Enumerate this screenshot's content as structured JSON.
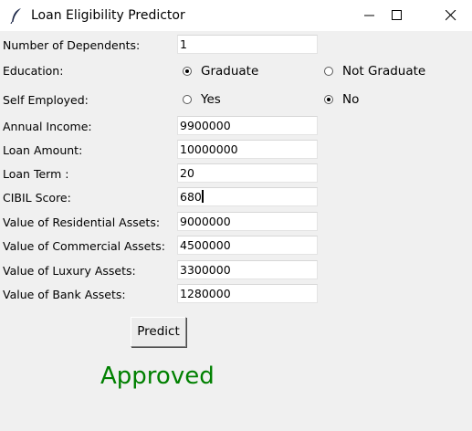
{
  "window": {
    "title": "Loan Eligibility Predictor"
  },
  "form": {
    "dependents": {
      "label": "Number of Dependents:",
      "value": "1"
    },
    "education": {
      "label": "Education:",
      "options": [
        {
          "label": "Graduate",
          "selected": true
        },
        {
          "label": "Not Graduate",
          "selected": false
        }
      ]
    },
    "self_employed": {
      "label": "Self Employed:",
      "options": [
        {
          "label": "Yes",
          "selected": false
        },
        {
          "label": "No",
          "selected": true
        }
      ]
    },
    "annual_income": {
      "label": "Annual Income:",
      "value": "9900000"
    },
    "loan_amount": {
      "label": "Loan Amount:",
      "value": "10000000"
    },
    "loan_term": {
      "label": "Loan Term :",
      "value": "20"
    },
    "cibil_score": {
      "label": "CIBIL Score:",
      "value": "680"
    },
    "residential_assets": {
      "label": "Value of Residential Assets:",
      "value": "9000000"
    },
    "commercial_assets": {
      "label": "Value of Commercial Assets:",
      "value": "4500000"
    },
    "luxury_assets": {
      "label": "Value of Luxury Assets:",
      "value": "3300000"
    },
    "bank_assets": {
      "label": "Value of Bank Assets:",
      "value": "1280000"
    }
  },
  "predict_button": {
    "label": "Predict"
  },
  "result": {
    "text": "Approved",
    "color": "#008000"
  }
}
